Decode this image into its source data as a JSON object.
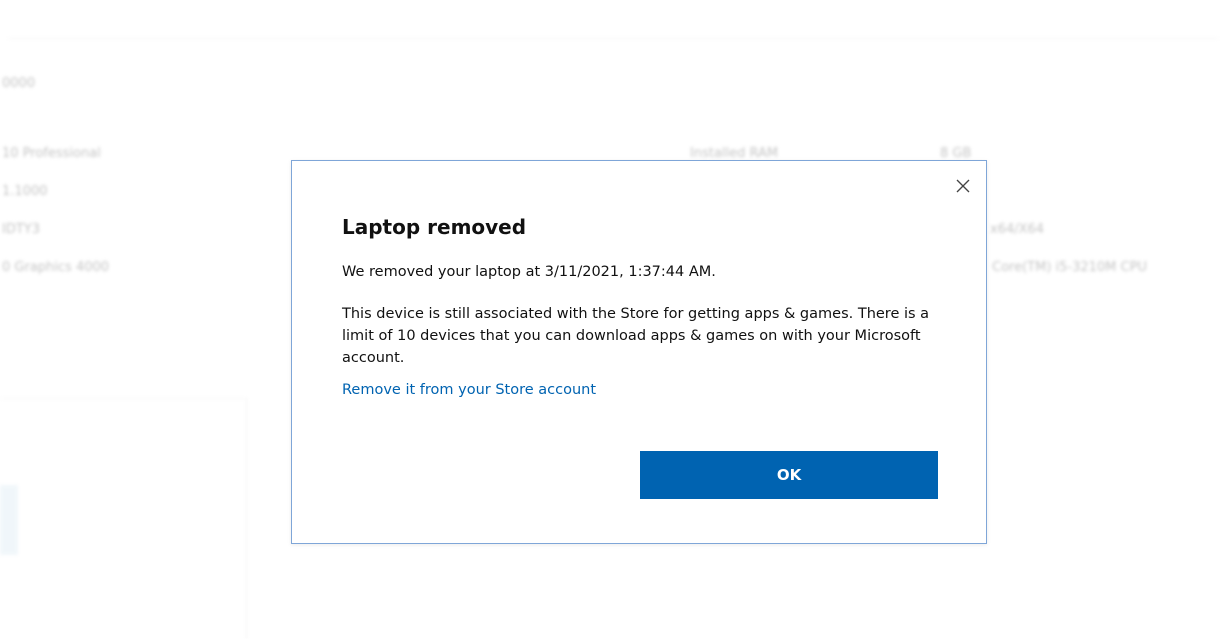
{
  "background": {
    "header_text": "0000",
    "rows": [
      {
        "col1": "10 Professional",
        "col2": "Installed RAM",
        "col3": "8 GB"
      },
      {
        "col1": "1.1000",
        "col2": "",
        "col3": ""
      },
      {
        "col1": "IDTY3",
        "col2": "",
        "col3": "x64/X64"
      },
      {
        "col1": "0 Graphics 4000",
        "col2": "",
        "col3": "Core(TM) i5-3210M CPU"
      }
    ]
  },
  "dialog": {
    "title": "Laptop removed",
    "removed_message": "We removed your laptop at 3/11/2021, 1:37:44 AM.",
    "info_message": "This device is still associated with the Store for getting apps & games. There is a limit of 10 devices that you can download apps & games on with your Microsoft account.",
    "link_label": "Remove it from your Store account",
    "ok_label": "OK",
    "close_icon": "close-icon"
  },
  "colors": {
    "accent": "#0063b1",
    "dialog_border": "#7fa6d8",
    "text": "#111111"
  }
}
